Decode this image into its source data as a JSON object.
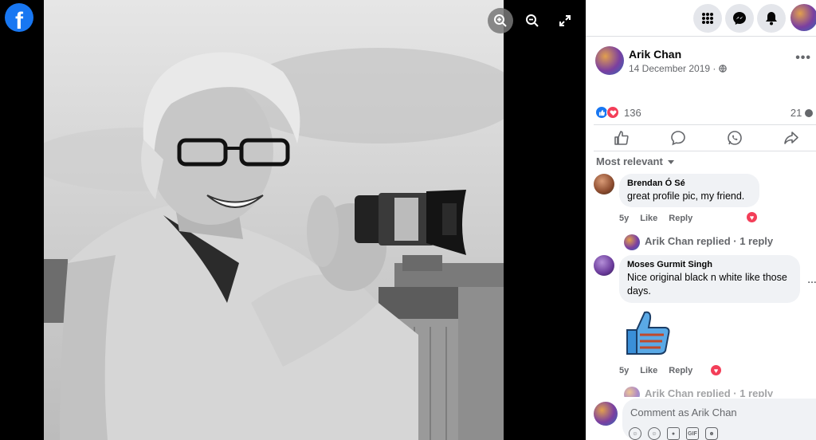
{
  "viewer": {
    "logo_letter": "f",
    "tools": [
      "zoom-in",
      "zoom-out",
      "fullscreen"
    ]
  },
  "post": {
    "author": "Arik Chan",
    "date": "14 December 2019",
    "date_sep": " · ",
    "reaction_count": "136",
    "comment_count": "21",
    "reaction_types": [
      "like",
      "love"
    ],
    "actions": [
      "like",
      "comment",
      "share-whatsapp",
      "share"
    ]
  },
  "comments_section": {
    "sort_label": "Most relevant"
  },
  "comments": [
    {
      "name": "Brendan Ó Sé",
      "text": "great profile pic, my friend.",
      "age": "5y",
      "like_label": "Like",
      "reply_label": "Reply",
      "reaction": "love",
      "replies_link": "Arik Chan replied · 1 reply"
    },
    {
      "name": "Moses Gurmit Singh",
      "text": "Nice original black n white like those days.",
      "age": "5y",
      "like_label": "Like",
      "reply_label": "Reply",
      "reaction": "love",
      "sticker": "thumbs-up-sticker",
      "replies_link": "Arik Chan replied · 1 reply"
    }
  ],
  "composer": {
    "placeholder": "Comment as Arik Chan",
    "tools": [
      "avatar-sticker",
      "emoji",
      "camera",
      "GIF",
      "sticker"
    ],
    "gif_label": "GIF"
  },
  "colors": {
    "brand": "#1877f2",
    "love": "#f33e58",
    "muted_text": "#65676b",
    "bubble_bg": "#f0f2f5"
  }
}
